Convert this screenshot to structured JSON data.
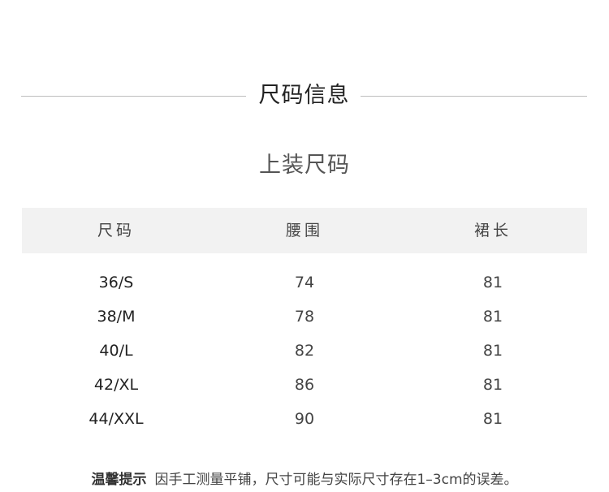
{
  "section_title": "尺码信息",
  "sub_title": "上装尺码",
  "table": {
    "headers": [
      "尺码",
      "腰围",
      "裙长"
    ],
    "rows": [
      [
        "36/S",
        "74",
        "81"
      ],
      [
        "38/M",
        "78",
        "81"
      ],
      [
        "40/L",
        "82",
        "81"
      ],
      [
        "42/XL",
        "86",
        "81"
      ],
      [
        "44/XXL",
        "90",
        "81"
      ]
    ]
  },
  "note": {
    "label": "温馨提示",
    "text": "因手工测量平铺，尺寸可能与实际尺寸存在1–3cm的误差。"
  }
}
